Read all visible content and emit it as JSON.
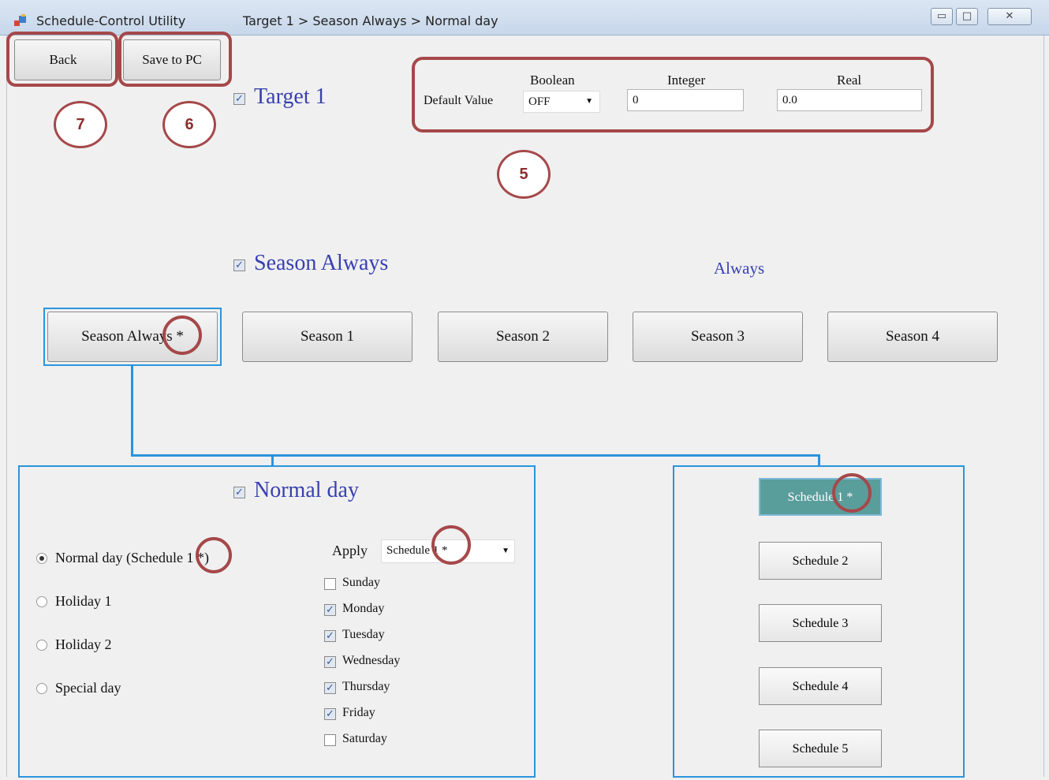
{
  "window": {
    "title": "Schedule-Control Utility",
    "breadcrumb": "Target 1 > Season Always > Normal day",
    "controls": {
      "minimize": "▭",
      "maximize": "□",
      "close": "✕"
    }
  },
  "toolbar": {
    "back_label": "Back",
    "save_label": "Save to PC"
  },
  "target": {
    "label": "Target 1",
    "checked": true
  },
  "defaults": {
    "label": "Default Value",
    "boolean_header": "Boolean",
    "integer_header": "Integer",
    "real_header": "Real",
    "boolean_value": "OFF",
    "integer_value": "0",
    "real_value": "0.0"
  },
  "season": {
    "label": "Season Always",
    "period": "Always",
    "checked": true
  },
  "season_buttons": [
    "Season Always *",
    "Season 1",
    "Season 2",
    "Season 3",
    "Season 4"
  ],
  "day": {
    "label": "Normal day",
    "checked": true,
    "options": [
      "Normal day (Schedule 1 *)",
      "Holiday 1",
      "Holiday 2",
      "Special day"
    ],
    "selected_option": "Normal day (Schedule 1 *)",
    "apply_label": "Apply",
    "apply_value": "Schedule 1 *",
    "weekdays": [
      {
        "name": "Sunday",
        "checked": false
      },
      {
        "name": "Monday",
        "checked": true
      },
      {
        "name": "Tuesday",
        "checked": true
      },
      {
        "name": "Wednesday",
        "checked": true
      },
      {
        "name": "Thursday",
        "checked": true
      },
      {
        "name": "Friday",
        "checked": true
      },
      {
        "name": "Saturday",
        "checked": false
      }
    ]
  },
  "schedules": [
    "Schedule 1 *",
    "Schedule 2",
    "Schedule 3",
    "Schedule 4",
    "Schedule 5"
  ],
  "callouts": [
    "7",
    "6",
    "5"
  ],
  "colors": {
    "accent_blue": "#2a94dd",
    "heading": "#3840b0",
    "callout": "#a5484a",
    "active_schedule": "#5a9e9c"
  }
}
